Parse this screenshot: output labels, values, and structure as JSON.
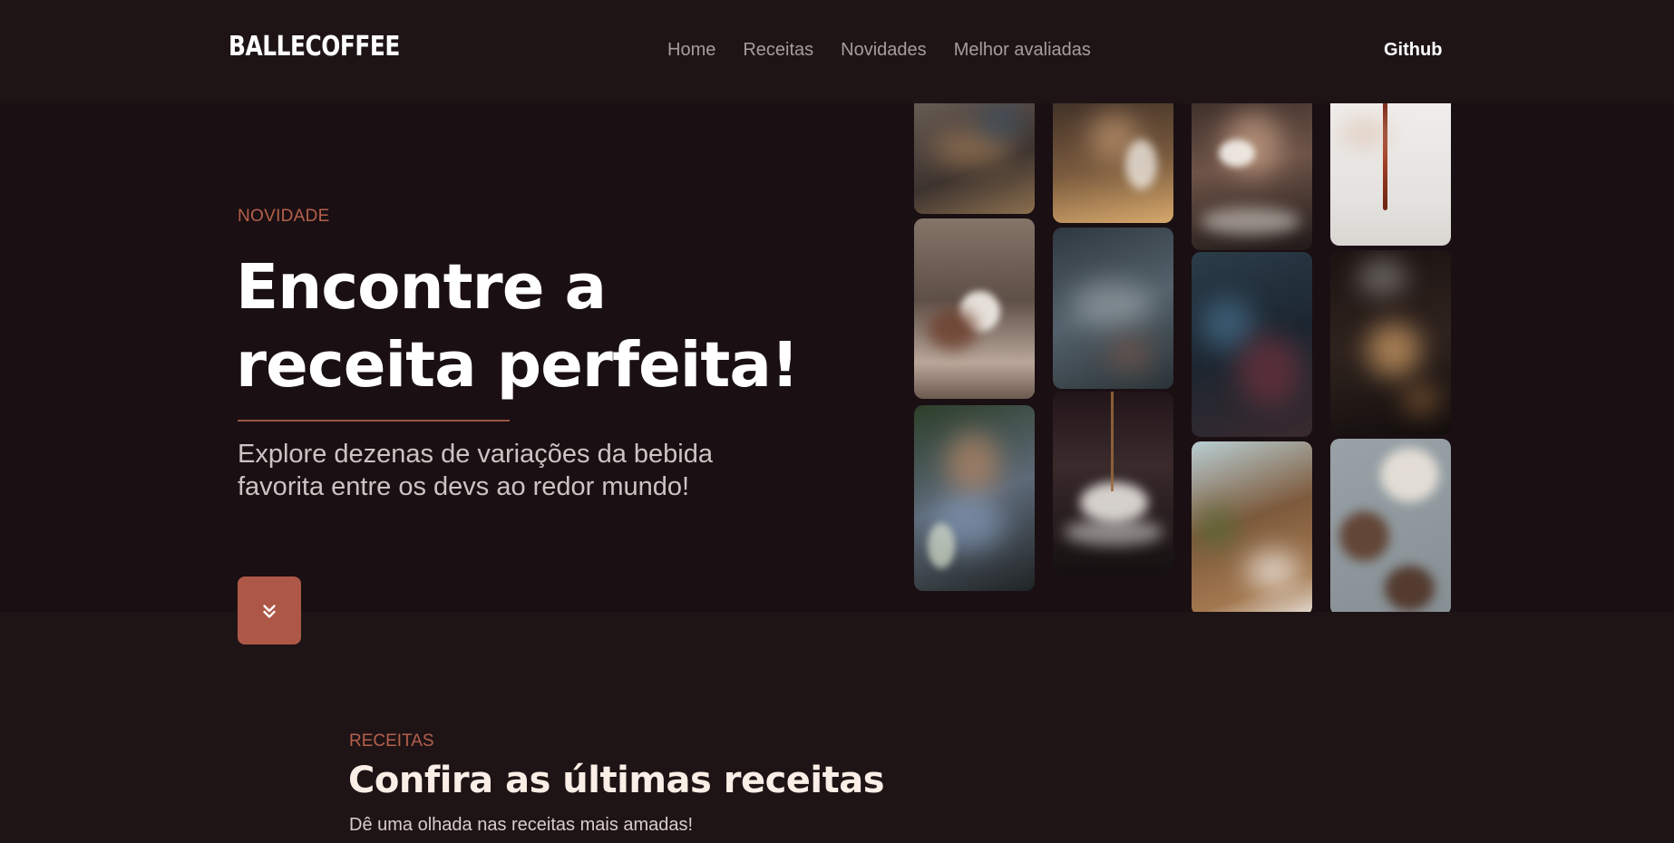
{
  "brand": {
    "name": "BALLECOFFEE"
  },
  "nav": {
    "items": [
      "Home",
      "Receitas",
      "Novidades",
      "Melhor avaliadas"
    ],
    "github": "Github"
  },
  "hero": {
    "eyebrow": "NOVIDADE",
    "title_line1": "Encontre a",
    "title_line2": "receita perfeita!",
    "subtitle": "Explore dezenas de variações da bebida favorita entre os devs ao redor mundo!",
    "scroll_icon": "chevrons-down-icon"
  },
  "gallery": {
    "photos": [
      {
        "name": "photo-team-laptops",
        "base": "#5a4e48",
        "accent": "#c49a6a"
      },
      {
        "name": "photo-hand-coffee-mug",
        "base": "#6b5a52",
        "accent": "#e8e1db"
      },
      {
        "name": "photo-man-laptop-cup",
        "base": "#2f3a2c",
        "accent": "#8aa0c0"
      },
      {
        "name": "photo-barista-machine",
        "base": "#3a2b22",
        "accent": "#e9c28a"
      },
      {
        "name": "photo-baristas-overhead",
        "base": "#3b4650",
        "accent": "#9aa6ac"
      },
      {
        "name": "photo-coffee-pour-cup",
        "base": "#1a1416",
        "accent": "#f2f0ec"
      },
      {
        "name": "photo-woman-drinking",
        "base": "#2a2220",
        "accent": "#efe7df"
      },
      {
        "name": "photo-dev-monitors",
        "base": "#1c2a33",
        "accent": "#3f6e8c"
      },
      {
        "name": "photo-desk-window",
        "base": "#6b4a2e",
        "accent": "#c3d6d8"
      },
      {
        "name": "photo-coffee-pouring",
        "base": "#e9e7e5",
        "accent": "#7a2a1a"
      },
      {
        "name": "photo-latte-art-pour",
        "base": "#1a1210",
        "accent": "#d8a46a"
      },
      {
        "name": "photo-espresso-beans",
        "base": "#8b9499",
        "accent": "#5b3826"
      }
    ]
  },
  "recipes": {
    "eyebrow": "RECEITAS",
    "title": "Confira as últimas receitas",
    "subtitle": "Dê uma olhada nas receitas mais amadas!"
  },
  "colors": {
    "accent": "#ad5847",
    "background": "#1e1416",
    "hero": "#1a0f12"
  }
}
